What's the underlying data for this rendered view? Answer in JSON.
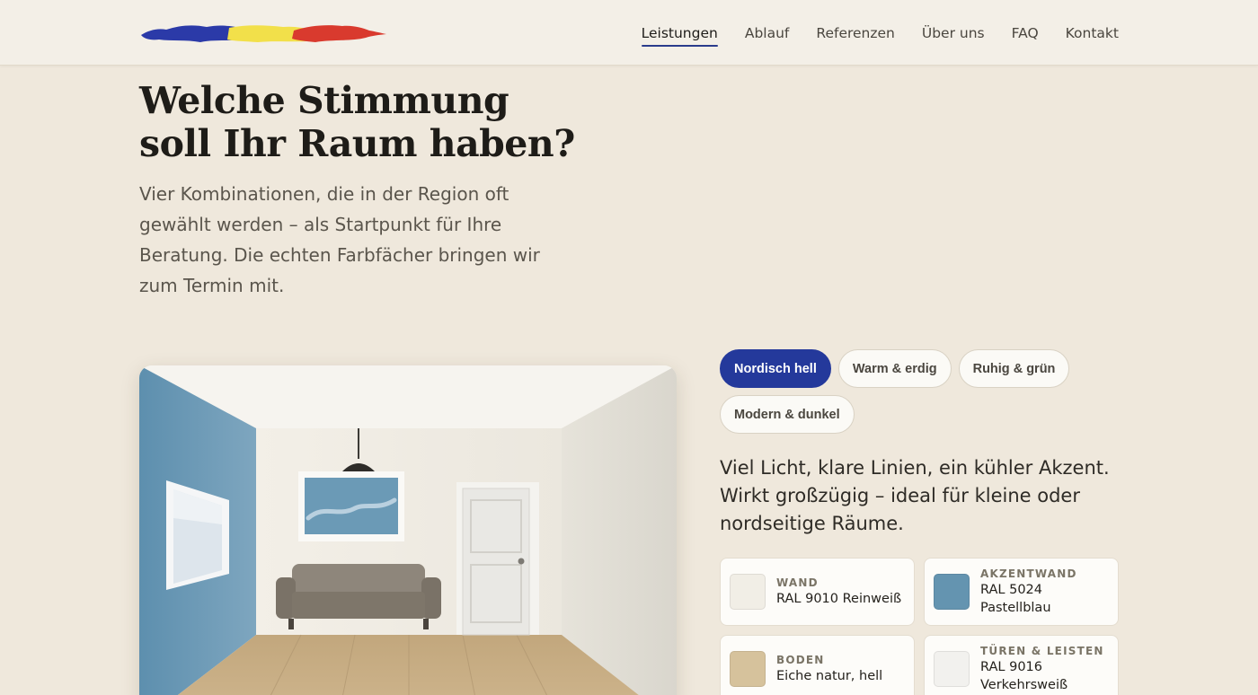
{
  "header": {
    "logo_colors": [
      "#2b3aa8",
      "#f2e04a",
      "#d93a2e"
    ],
    "nav": [
      {
        "label": "Leistungen",
        "active": true
      },
      {
        "label": "Ablauf"
      },
      {
        "label": "Referenzen"
      },
      {
        "label": "Über uns"
      },
      {
        "label": "FAQ"
      },
      {
        "label": "Kontakt"
      }
    ]
  },
  "hero": {
    "title_line1": "Welche Stimmung",
    "title_line2": "soll Ihr Raum haben?",
    "lead": "Vier Kombinationen, die in der Region oft gewählt werden – als Startpunkt für Ihre Beratung. Die echten Farbfächer bringen wir zum Termin mit."
  },
  "moods": {
    "chips": [
      {
        "label": "Nordisch hell",
        "active": true
      },
      {
        "label": "Warm & erdig"
      },
      {
        "label": "Ruhig & grün"
      },
      {
        "label": "Modern & dunkel"
      }
    ],
    "description": "Viel Licht, klare Linien, ein kühler Akzent. Wirkt großzügig – ideal für kleine oder nordseitige Räume.",
    "swatches": [
      {
        "label": "Wand",
        "value": "RAL 9010 Reinweiß",
        "color": "#f1eee6"
      },
      {
        "label": "Akzentwand",
        "value": "RAL 5024 Pastellblau",
        "color": "#6494b0"
      },
      {
        "label": "Boden",
        "value": "Eiche natur, hell",
        "color": "#d6c29c"
      },
      {
        "label": "Türen & Leisten",
        "value": "RAL 9016 Verkehrsweiß",
        "color": "#f2f1ee"
      }
    ]
  },
  "room": {
    "accent_color": "#6a9ab7",
    "wall_color": "#f1ede6",
    "floor_color": "#c9ad82"
  }
}
